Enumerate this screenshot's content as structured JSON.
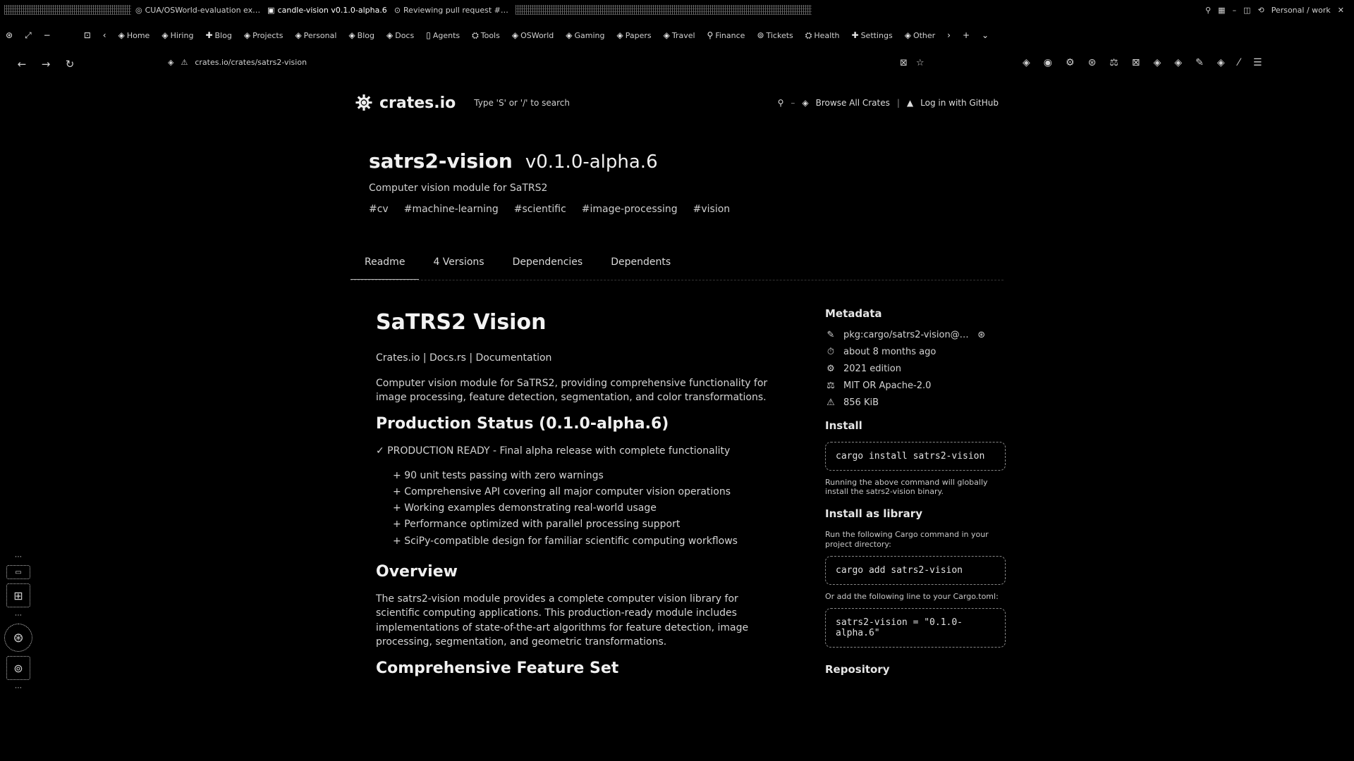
{
  "browser": {
    "tabs": [
      {
        "label": "CUA/OSWorld-evaluation ex…",
        "active": false
      },
      {
        "label": "candle-vision v0.1.0-alpha.6",
        "active": true
      },
      {
        "label": "Reviewing pull request #…",
        "active": false
      }
    ],
    "window_controls": [
      "minimize",
      "maximize",
      "close"
    ],
    "right_label": "Personal / work",
    "bookmarks": [
      "Home",
      "Hiring",
      "Blog",
      "Projects",
      "Personal",
      "Blog",
      "Docs",
      "Agents",
      "Tools",
      "OSWorld",
      "Gaming",
      "Papers",
      "Travel",
      "Finance",
      "Tickets",
      "Health",
      "Settings",
      "Other"
    ],
    "url": "crates.io/crates/satrs2-vision",
    "url_icon": "site-info-icon"
  },
  "site": {
    "logo_text": "crates.io",
    "search_placeholder": "Type 'S' or '/' to search",
    "browse_label": "Browse All Crates",
    "login_label": "Log in with GitHub"
  },
  "crate": {
    "name": "satrs2-vision",
    "version": "v0.1.0-alpha.6",
    "description": "Computer vision module for SaTRS2",
    "keywords": [
      "#cv",
      "#machine-learning",
      "#scientific",
      "#image-processing",
      "#vision"
    ],
    "tabs": [
      "Readme",
      "4 Versions",
      "Dependencies",
      "Dependents"
    ]
  },
  "readme": {
    "title": "SaTRS2 Vision",
    "subtitle": "Crates.io | Docs.rs | Documentation",
    "intro": "Computer vision module for SaTRS2, providing comprehensive functionality for image processing, feature detection, segmentation, and color transformations.",
    "status_heading": "Production Status (0.1.0-alpha.6)",
    "status_line": "✓ PRODUCTION READY - Final alpha release with complete functionality",
    "status_items": [
      "90 unit tests passing with zero warnings",
      "Comprehensive API covering all major computer vision operations",
      "Working examples demonstrating real-world usage",
      "Performance optimized with parallel processing support",
      "SciPy-compatible design for familiar scientific computing workflows"
    ],
    "overview_heading": "Overview",
    "overview_text": "The satrs2-vision module provides a complete computer vision library for scientific computing applications. This production-ready module includes implementations of state-of-the-art algorithms for feature detection, image processing, segmentation, and geometric transformations.",
    "features_heading": "Comprehensive Feature Set"
  },
  "sidebar": {
    "metadata_heading": "Metadata",
    "meta": [
      {
        "icon": "calendar-icon",
        "text": "pkg:cargo/satrs2-vision@…"
      },
      {
        "icon": "clock-icon",
        "text": "about 8 months ago"
      },
      {
        "icon": "rust-icon",
        "text": "2021 edition"
      },
      {
        "icon": "license-icon",
        "text": "MIT OR Apache-2.0"
      },
      {
        "icon": "weight-icon",
        "text": "856 KiB"
      }
    ],
    "install_heading": "Install",
    "install_cmd": "cargo install satrs2-vision",
    "install_note": "Running the above command will globally install the satrs2-vision binary.",
    "library_heading": "Install as library",
    "library_note": "Run the following Cargo command in your project directory:",
    "add_cmd": "cargo add satrs2-vision",
    "toml_note": "Or add the following line to your Cargo.toml:",
    "toml_line": "satrs2-vision = \"0.1.0-alpha.6\"",
    "repository_heading": "Repository"
  }
}
